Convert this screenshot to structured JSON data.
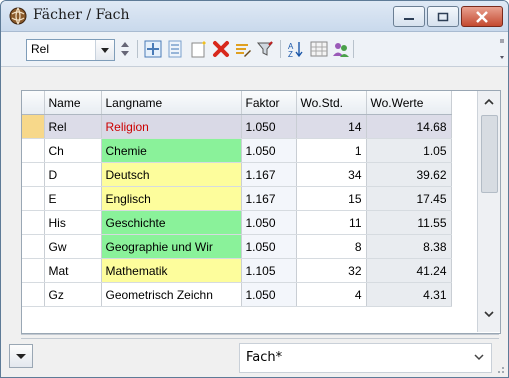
{
  "window": {
    "title": "Fächer / Fach"
  },
  "toolbar": {
    "filter_value": "Rel",
    "icons": [
      "spin-icon",
      "grid-add-icon",
      "list-icon",
      "new-record-icon",
      "delete-icon",
      "edit-icon",
      "filter-icon",
      "sort-az-icon",
      "table-icon",
      "users-icon"
    ]
  },
  "grid": {
    "columns": [
      "Name",
      "Langname",
      "Faktor",
      "Wo.Std.",
      "Wo.Werte"
    ],
    "rows": [
      {
        "name": "Rel",
        "langname": "Religion",
        "faktor": "1.050",
        "wostd": "14",
        "wowerte": "14.68",
        "color": "#d9d9e6",
        "text_color": "#cc0000",
        "selected": true
      },
      {
        "name": "Ch",
        "langname": "Chemie",
        "faktor": "1.050",
        "wostd": "1",
        "wowerte": "1.05",
        "color": "#8af29a",
        "text_color": "#000000",
        "selected": false
      },
      {
        "name": "D",
        "langname": "Deutsch",
        "faktor": "1.167",
        "wostd": "34",
        "wowerte": "39.62",
        "color": "#fdfd9c",
        "text_color": "#000000",
        "selected": false
      },
      {
        "name": "E",
        "langname": "Englisch",
        "faktor": "1.167",
        "wostd": "15",
        "wowerte": "17.45",
        "color": "#fdfd9c",
        "text_color": "#000000",
        "selected": false
      },
      {
        "name": "His",
        "langname": "Geschichte",
        "faktor": "1.050",
        "wostd": "11",
        "wowerte": "11.55",
        "color": "#8af29a",
        "text_color": "#000000",
        "selected": false
      },
      {
        "name": "Gw",
        "langname": "Geographie und Wir",
        "faktor": "1.050",
        "wostd": "8",
        "wowerte": "8.38",
        "color": "#8af29a",
        "text_color": "#000000",
        "selected": false
      },
      {
        "name": "Mat",
        "langname": "Mathematik",
        "faktor": "1.105",
        "wostd": "32",
        "wowerte": "41.24",
        "color": "#fdfd9c",
        "text_color": "#000000",
        "selected": false
      },
      {
        "name": "Gz",
        "langname": "Geometrisch Zeichn",
        "faktor": "1.050",
        "wostd": "4",
        "wowerte": "4.31",
        "color": "#ffffff",
        "text_color": "#000000",
        "selected": false
      }
    ]
  },
  "bottom": {
    "view_value": "Fach*"
  }
}
